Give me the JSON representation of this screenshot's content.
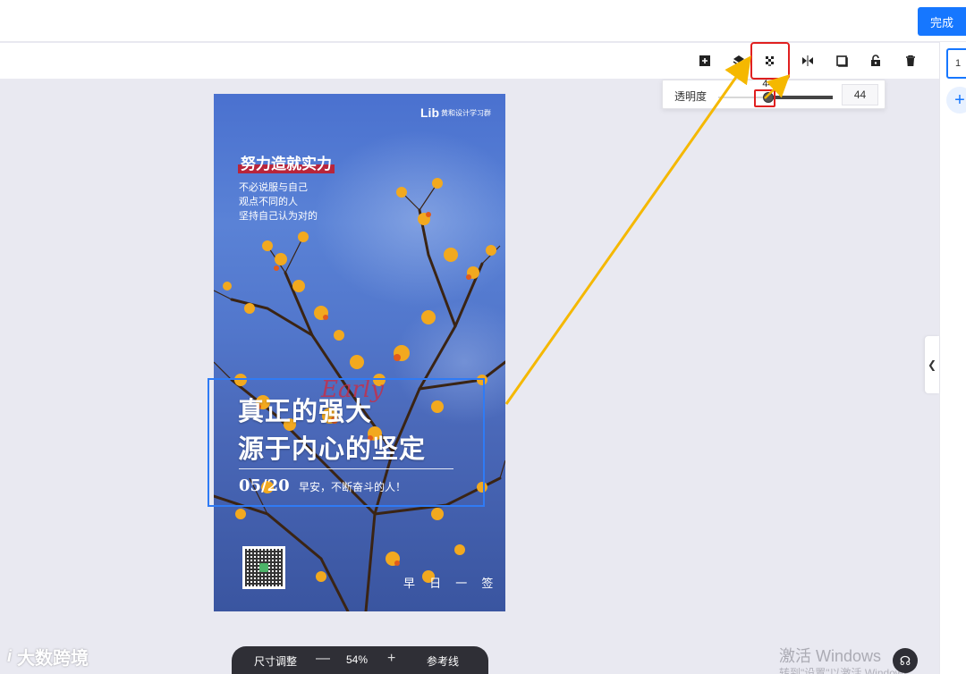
{
  "topbar": {
    "done_label": "完成"
  },
  "toolbar": {
    "tools": [
      {
        "name": "add-icon"
      },
      {
        "name": "layers-icon"
      },
      {
        "name": "transparency-icon"
      },
      {
        "name": "flip-icon"
      },
      {
        "name": "copy-icon"
      },
      {
        "name": "lock-icon"
      },
      {
        "name": "delete-icon"
      }
    ]
  },
  "opacity_popover": {
    "label": "透明度",
    "value": "44",
    "tooltip": "44",
    "level_percent": 44
  },
  "right_panel": {
    "page_number": "1",
    "add_label": "+"
  },
  "poster": {
    "logo_main": "Lib",
    "logo_sub": "黄和设计学习群",
    "headline": "努力造就实力",
    "sublines": [
      "不必说服与自己",
      "观点不同的人",
      "坚持自己认为对的"
    ],
    "main_line1": "真正的强大",
    "main_line2": "源于内心的坚定",
    "script": "Early",
    "date": "05/20",
    "greeting": "早安，不断奋斗的人！",
    "stamp": "早 日 一 签"
  },
  "zoom_bar": {
    "size_adjust": "尺寸调整",
    "minus": "—",
    "zoom": "54%",
    "plus": "+",
    "guides": "参考线"
  },
  "watermark": {
    "logo_mark": "i",
    "logo_text": "大数跨境"
  },
  "os_overlay": {
    "activate_title": "激活 Windows",
    "activate_sub": "转到\"设置\"以激活 Windows。"
  },
  "colors": {
    "primary": "#1677ff",
    "highlight_red": "#e02020",
    "arrow_yellow": "#f5b800",
    "selection_blue": "#2f7bf5"
  }
}
